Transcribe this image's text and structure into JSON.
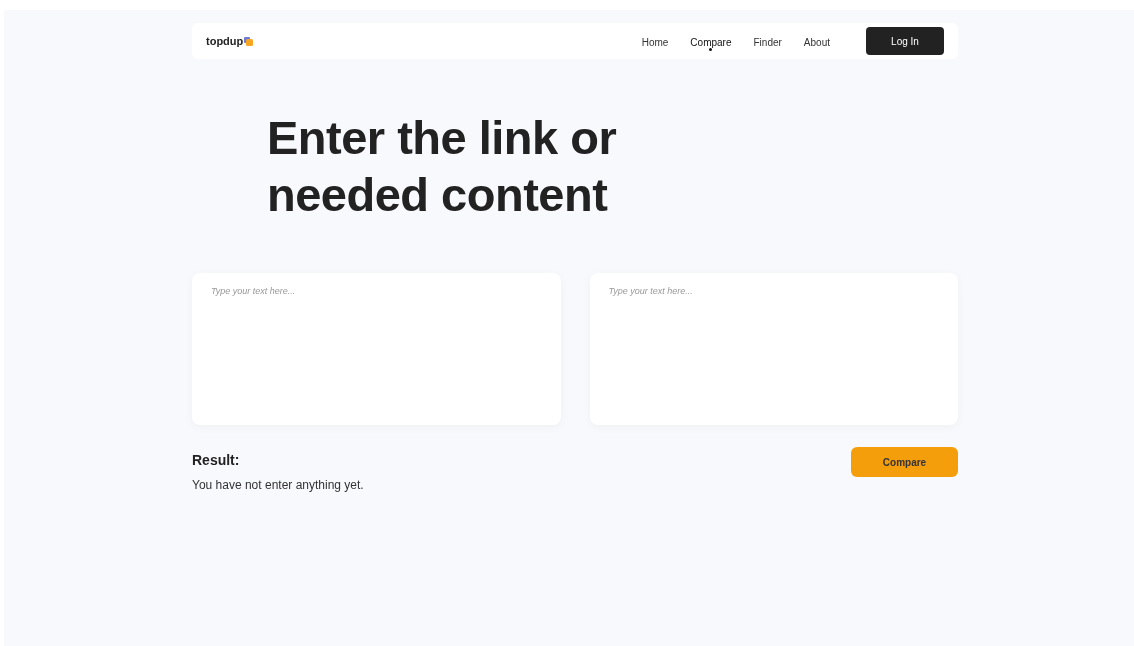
{
  "logo": "topdup",
  "nav": [
    {
      "label": "Home",
      "selected": false
    },
    {
      "label": "Compare",
      "selected": true
    },
    {
      "label": "Finder",
      "selected": false
    },
    {
      "label": "About",
      "selected": false
    }
  ],
  "login_button": "Log In",
  "heading": [
    "Enter the link or",
    "needed content"
  ],
  "inputs": [
    {
      "placeholder": "Type your text here..."
    },
    {
      "placeholder": "Type your text here..."
    }
  ],
  "result": {
    "title": "Result:",
    "text": "You have not enter anything yet."
  },
  "compare_button": "Compare"
}
